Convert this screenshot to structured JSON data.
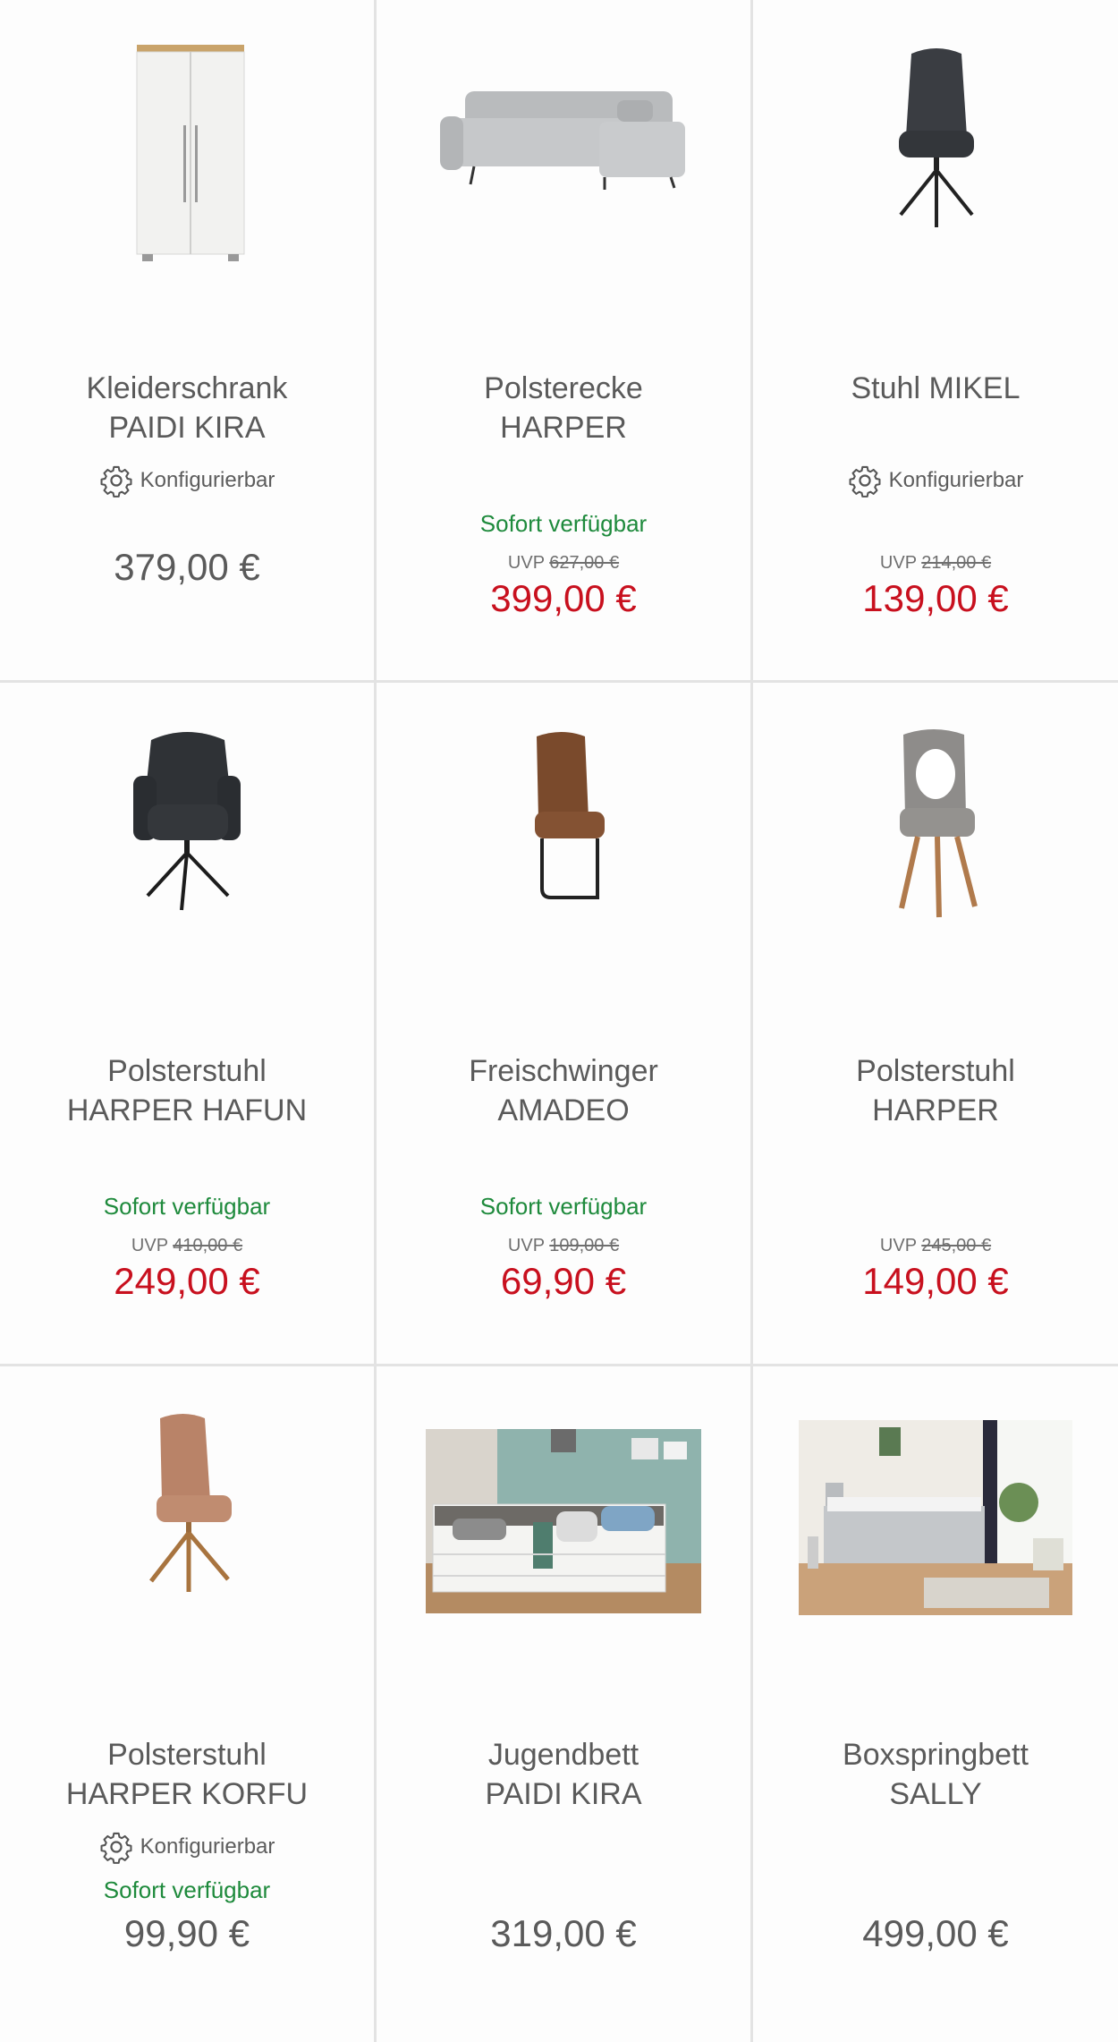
{
  "colors": {
    "sale_price": "#c8101e",
    "available": "#1e8a3c",
    "regular_price": "#5a5a5a",
    "divider": "#e3e3e3"
  },
  "products": [
    {
      "name_line1": "Kleiderschrank",
      "name_line2": "PAIDI KIRA",
      "image": "wardrobe-image",
      "configurable_label": "Konfigurierbar",
      "configurable_icon": "gear-icon",
      "price": "379,00 €"
    },
    {
      "name_line1": "Polsterecke",
      "name_line2": "HARPER",
      "image": "corner-sofa-image",
      "availability": "Sofort verfügbar",
      "uvp_label": "UVP",
      "uvp_price": "627,00 €",
      "price": "399,00 €"
    },
    {
      "name_line1": "Stuhl MIKEL",
      "name_line2": "",
      "image": "chair-image",
      "configurable_label": "Konfigurierbar",
      "configurable_icon": "gear-icon",
      "uvp_label": "UVP",
      "uvp_price": "214,00 €",
      "price": "139,00 €"
    },
    {
      "name_line1": "Polsterstuhl",
      "name_line2": "HARPER HAFUN",
      "image": "armchair-image",
      "availability": "Sofort verfügbar",
      "uvp_label": "UVP",
      "uvp_price": "410,00 €",
      "price": "249,00 €"
    },
    {
      "name_line1": "Freischwinger",
      "name_line2": "AMADEO",
      "image": "cantilever-chair-image",
      "availability": "Sofort verfügbar",
      "uvp_label": "UVP",
      "uvp_price": "109,00 €",
      "price": "69,90 €"
    },
    {
      "name_line1": "Polsterstuhl",
      "name_line2": "HARPER",
      "image": "grey-chair-image",
      "uvp_label": "UVP",
      "uvp_price": "245,00 €",
      "price": "149,00 €"
    },
    {
      "name_line1": "Polsterstuhl",
      "name_line2": "HARPER KORFU",
      "image": "brown-chair-image",
      "configurable_label": "Konfigurierbar",
      "configurable_icon": "gear-icon",
      "availability": "Sofort verfügbar",
      "price": "99,90 €"
    },
    {
      "name_line1": "Jugendbett",
      "name_line2": "PAIDI KIRA",
      "image": "youth-bed-photo",
      "price": "319,00 €"
    },
    {
      "name_line1": "Boxspringbett",
      "name_line2": "SALLY",
      "image": "boxspring-bed-photo",
      "price": "499,00 €"
    }
  ]
}
